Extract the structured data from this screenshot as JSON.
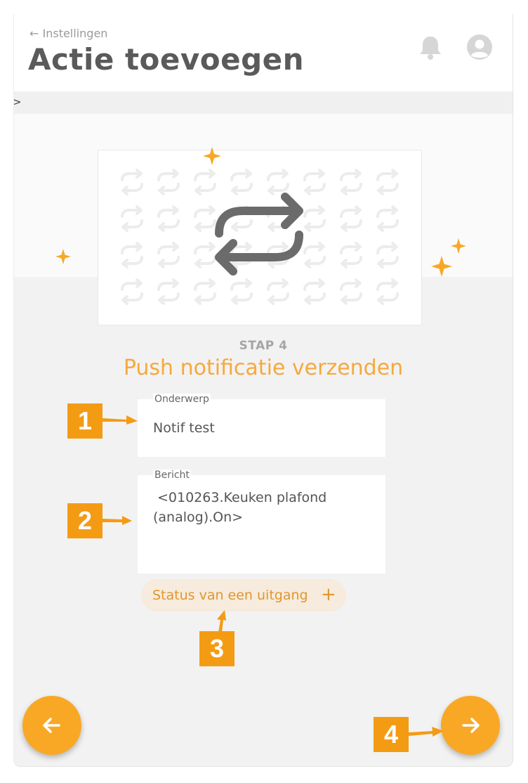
{
  "header": {
    "back_label": "← Instellingen",
    "title": "Actie toevoegen",
    "icons": [
      "bell-icon",
      "user-avatar-icon"
    ]
  },
  "breadcrumb": {
    "glyph": ">"
  },
  "illustration": {
    "icon": "repeat-icon",
    "pattern_icon": "repeat-icon"
  },
  "step": {
    "label": "STAP 4",
    "title": "Push notificatie verzenden"
  },
  "form": {
    "subject": {
      "label": "Onderwerp",
      "value": "Notif test"
    },
    "message": {
      "label": "Bericht",
      "line1": "<010263.Keuken plafond",
      "line2": "(analog).On>"
    }
  },
  "chip": {
    "label": "Status van een uitgang",
    "icon": "+"
  },
  "nav": {
    "back_icon": "arrow-left-icon",
    "next_icon": "arrow-right-icon"
  },
  "annotations": [
    "1",
    "2",
    "3",
    "4"
  ],
  "colors": {
    "accent": "#f9a825",
    "title_orange": "#f6a93b",
    "marker_orange": "#f49b14",
    "text": "#5a5a5a"
  }
}
